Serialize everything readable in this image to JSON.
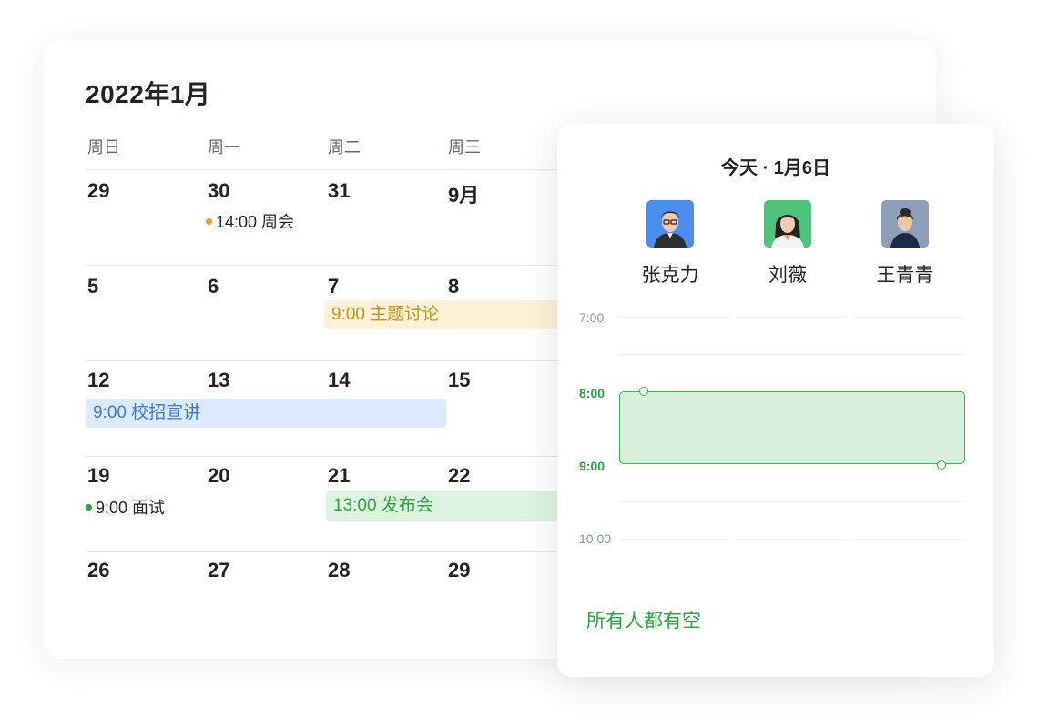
{
  "calendar": {
    "title": "2022年1月",
    "weekdays": [
      "周日",
      "周一",
      "周二",
      "周三"
    ],
    "weeks": [
      [
        "29",
        "30",
        "31",
        "9月"
      ],
      [
        "5",
        "6",
        "7",
        "8"
      ],
      [
        "12",
        "13",
        "14",
        "15"
      ],
      [
        "19",
        "20",
        "21",
        "22"
      ],
      [
        "26",
        "27",
        "28",
        "29"
      ]
    ],
    "events": {
      "weekly_meeting": {
        "label": "14:00 周会",
        "color": "#f5912c"
      },
      "topic_discussion": {
        "label": "9:00  主题讨论",
        "color": "#c49310",
        "bg": "#fdf1d8"
      },
      "campus_talk": {
        "label": "9:00  校招宣讲",
        "color": "#3a7ad9",
        "bg": "#dde9fc"
      },
      "interview": {
        "label": "9:00 面试",
        "color": "#2ea343"
      },
      "launch": {
        "label": "13:00  发布会",
        "color": "#2ea343",
        "bg": "#dcf3e0"
      }
    }
  },
  "panel": {
    "title": "今天 · 1月6日",
    "people": [
      {
        "name": "张克力",
        "avatar_bg": "#4a8ff0",
        "avatar_icon": "man-avatar"
      },
      {
        "name": "刘薇",
        "avatar_bg": "#4fc37a",
        "avatar_icon": "woman-avatar"
      },
      {
        "name": "王青青",
        "avatar_bg": "#8e9fb8",
        "avatar_icon": "woman-avatar"
      }
    ],
    "times": [
      "7:00",
      "8:00",
      "9:00",
      "10:00"
    ],
    "availability": "所有人都有空",
    "accent": "#2ea343"
  }
}
